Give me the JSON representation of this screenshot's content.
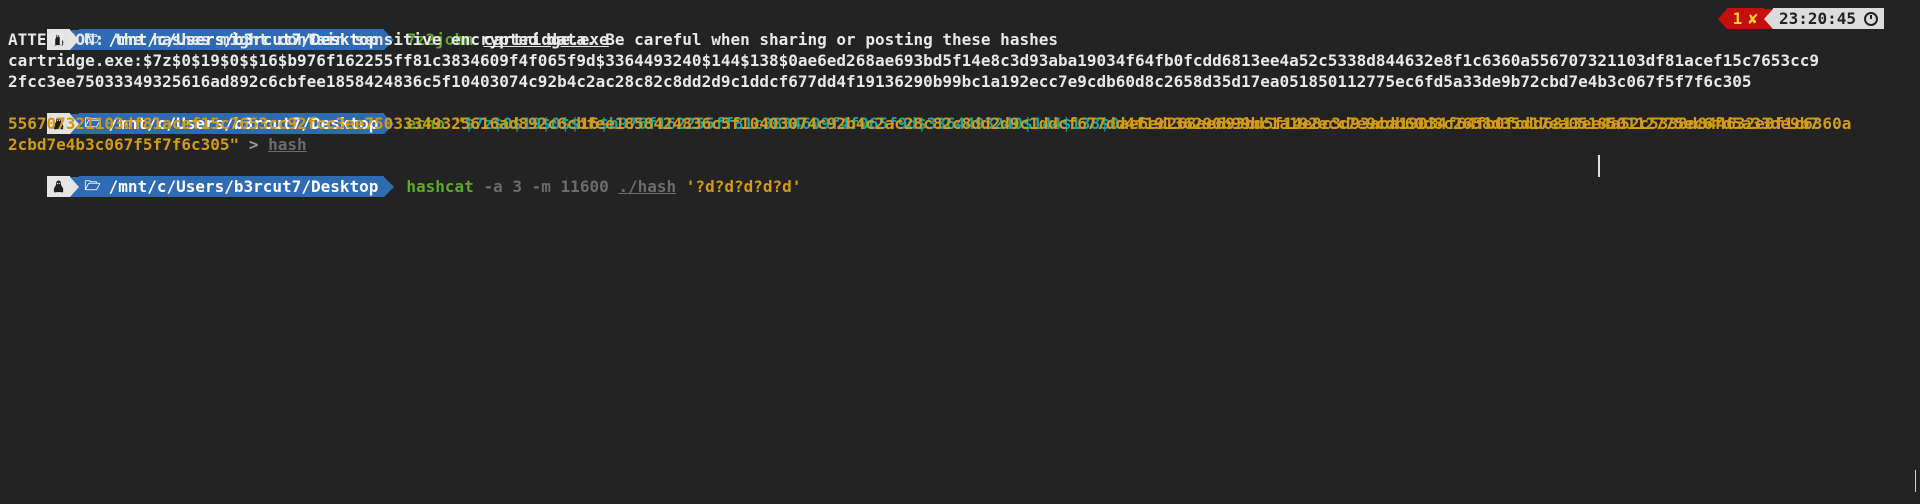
{
  "prompt": {
    "os_icon": "tux-icon",
    "folder_icon": "folder-icon",
    "path": "/mnt/c/Users/b3rcut7/Desktop"
  },
  "right_prompt": {
    "exit_code": "1",
    "error_icon": "✘",
    "time": "23:20:45"
  },
  "lines": {
    "cmd1": {
      "command": "7z2john",
      "arg": "cartridge.exe"
    },
    "out1": "ATTENTION: the hashes might contain sensitive encrypted data. Be careful when sharing or posting these hashes",
    "out2": "cartridge.exe:$7z$0$19$0$$16$b976f162255ff81c3834609f4f065f9d$3364493240$144$138$0ae6ed268ae693bd5f14e8c3d93aba19034f64fb0fcdd6813ee4a52c5338d844632e8f1c6360a556707321103df81acef15c7653cc9",
    "out3": "2fcc3ee75033349325616ad892c6cbfee1858424836c5f10403074c92b4c2ac28c82c8dd2d9c1ddcf677dd4f19136290b99bc1a192ecc7e9cdb60d8c2658d35d17ea051850112775ec6fd5a33de9b72cbd7e4b3c067f5f7f6c305",
    "cmd2": {
      "command": "echo",
      "q1": "\"",
      "p1": "$7z",
      "p2": "$0$19$0$$",
      "p3": "16",
      "p4": "$b976f162255ff81c3834609f4f065f9d$3364493240$144$138$0",
      "p5": "ae6ed268ae693bd5f14e8c3d93aba19034f64fb0fcdd6813ee4a52c5338d844632e8f1c6360a",
      "cont1": "556707321103df81acef15c7653cc92fcc3ee75033349325616ad892c6cbfee1858424836c5f10403074c92b4c2ac28c82c8dd2d9c1ddcf677dd4f19136290b99bc1a192ecc7e9cdb60d8c2658d35d17ea051850112775ec6fd5a33de9b7",
      "cont2": "2cbd7e4b3c067f5f7f6c305\"",
      "redirect": " > ",
      "target": "hash"
    },
    "cmd3": {
      "command": "hashcat",
      "opt_a": "-a",
      "val_a": "3",
      "opt_m": "-m",
      "val_m": "11600",
      "file": "./hash",
      "mask": "'?d?d?d?d?d'"
    }
  },
  "colors": {
    "background": "#232323",
    "prompt_path_bg": "#2f6bb3",
    "command_green": "#5fa82b",
    "string_yellow": "#d29a16",
    "string_cyan": "#19a8a8",
    "error_red": "#c40f0f"
  }
}
